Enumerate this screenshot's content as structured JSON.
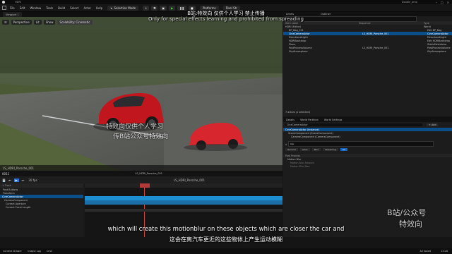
{
  "app": {
    "title": "Unreal Editor",
    "project_name": "Double_amp",
    "level_tab": "HDRI"
  },
  "menu": [
    "File",
    "Edit",
    "Window",
    "Tools",
    "Build",
    "Select",
    "Actor",
    "Help"
  ],
  "toolbar": {
    "mode": "Selection Mode",
    "platforms": "Platforms",
    "pixel_streaming": "Pixel Str"
  },
  "viewport": {
    "buttons": [
      "Perspective",
      "Lit",
      "Show",
      "Scalability: Cinematic"
    ],
    "camera_label": "LS_HDRI_Porsche_001",
    "colors": {
      "car": "#c2161e",
      "grass": "#4b5a34",
      "road": "#5a5c5a"
    }
  },
  "outliner": {
    "tab": "Levels",
    "tab2": "Outliner",
    "search_placeholder": "Search",
    "columns": [
      "Item Label",
      "Sequence",
      "Type"
    ],
    "rows": [
      {
        "label": "HDRI (Editor)",
        "seq": "",
        "type": "World",
        "selected": false
      },
      {
        "label": "BP_Bag_011",
        "seq": "",
        "type": "Edit BP_Bag",
        "selected": false
      },
      {
        "label": "CineCameraActor",
        "seq": "LS_HDRI_Porsche_001",
        "type": "CineCameraActor",
        "selected": true
      },
      {
        "label": "DirectionalLight",
        "seq": "",
        "type": "DirectionalLight",
        "selected": false
      },
      {
        "label": "HDRIBackdrop",
        "seq": "",
        "type": "Edit HDRIBackdrop",
        "selected": false
      },
      {
        "label": "Plane",
        "seq": "",
        "type": "StaticMeshActor",
        "selected": false
      },
      {
        "label": "PostProcessVolume",
        "seq": "LS_HDRI_Porsche_001",
        "type": "PostProcessVolume",
        "selected": false
      },
      {
        "label": "SkyAtmosphere",
        "seq": "",
        "type": "SkyAtmosphere",
        "selected": false
      }
    ],
    "footer": "7 actors (1 selected)"
  },
  "details": {
    "tabs": [
      "Details",
      "World Partition",
      "World Settings"
    ],
    "actor_name": "CineCameraActor",
    "add_button": "+ Add",
    "components": [
      {
        "label": "CineCameraActor (Instance)",
        "selected": true
      },
      {
        "label": "SceneComponent (SceneComponent)",
        "selected": false
      },
      {
        "label": "CameraComponent (CameraComponent)",
        "selected": false
      }
    ],
    "edit_in_cpp": "Edit in C++",
    "search_value": "blur",
    "filter_tabs": [
      "General",
      "Actor",
      "Misc",
      "Streaming",
      "All"
    ],
    "section": "Post Process",
    "subsection": "Motion Blur",
    "props": [
      "Motion Blur Amount",
      "Motion Blur Max"
    ]
  },
  "sequencer": {
    "tab": "Sequencer",
    "timecode": "0011",
    "fps": "30 fps",
    "sequence_name": "LS_HDRI_Porsche_001",
    "tracks": [
      "Track",
      "Post Buttons",
      "Transform",
      "CineCameraActor",
      "CameraComponent",
      "Current Aperture",
      "Current Focal Length"
    ],
    "add_track": "+ Track"
  },
  "statusbar": {
    "items": [
      "Content Drawer",
      "Output Log",
      "Cmd"
    ],
    "right": "All Saved",
    "clock": "13:28"
  },
  "overlay": {
    "watermark_cn": "B站:特效向 仅供个人学习 禁止传播",
    "watermark_en": "Only for special effects learning and prohibited from spreading",
    "corner_cn_1": "B站/公众号",
    "corner_cn_2": "特效向",
    "subtitle_en": "which will create this motionblur on these objects which are closer the car and",
    "subtitle_cn": "这会在离汽车更近的这些物体上产生运动模糊",
    "viewport_wm_1": "特效向仅供个人学习",
    "viewport_wm_2": "传B站公众号特效向"
  }
}
